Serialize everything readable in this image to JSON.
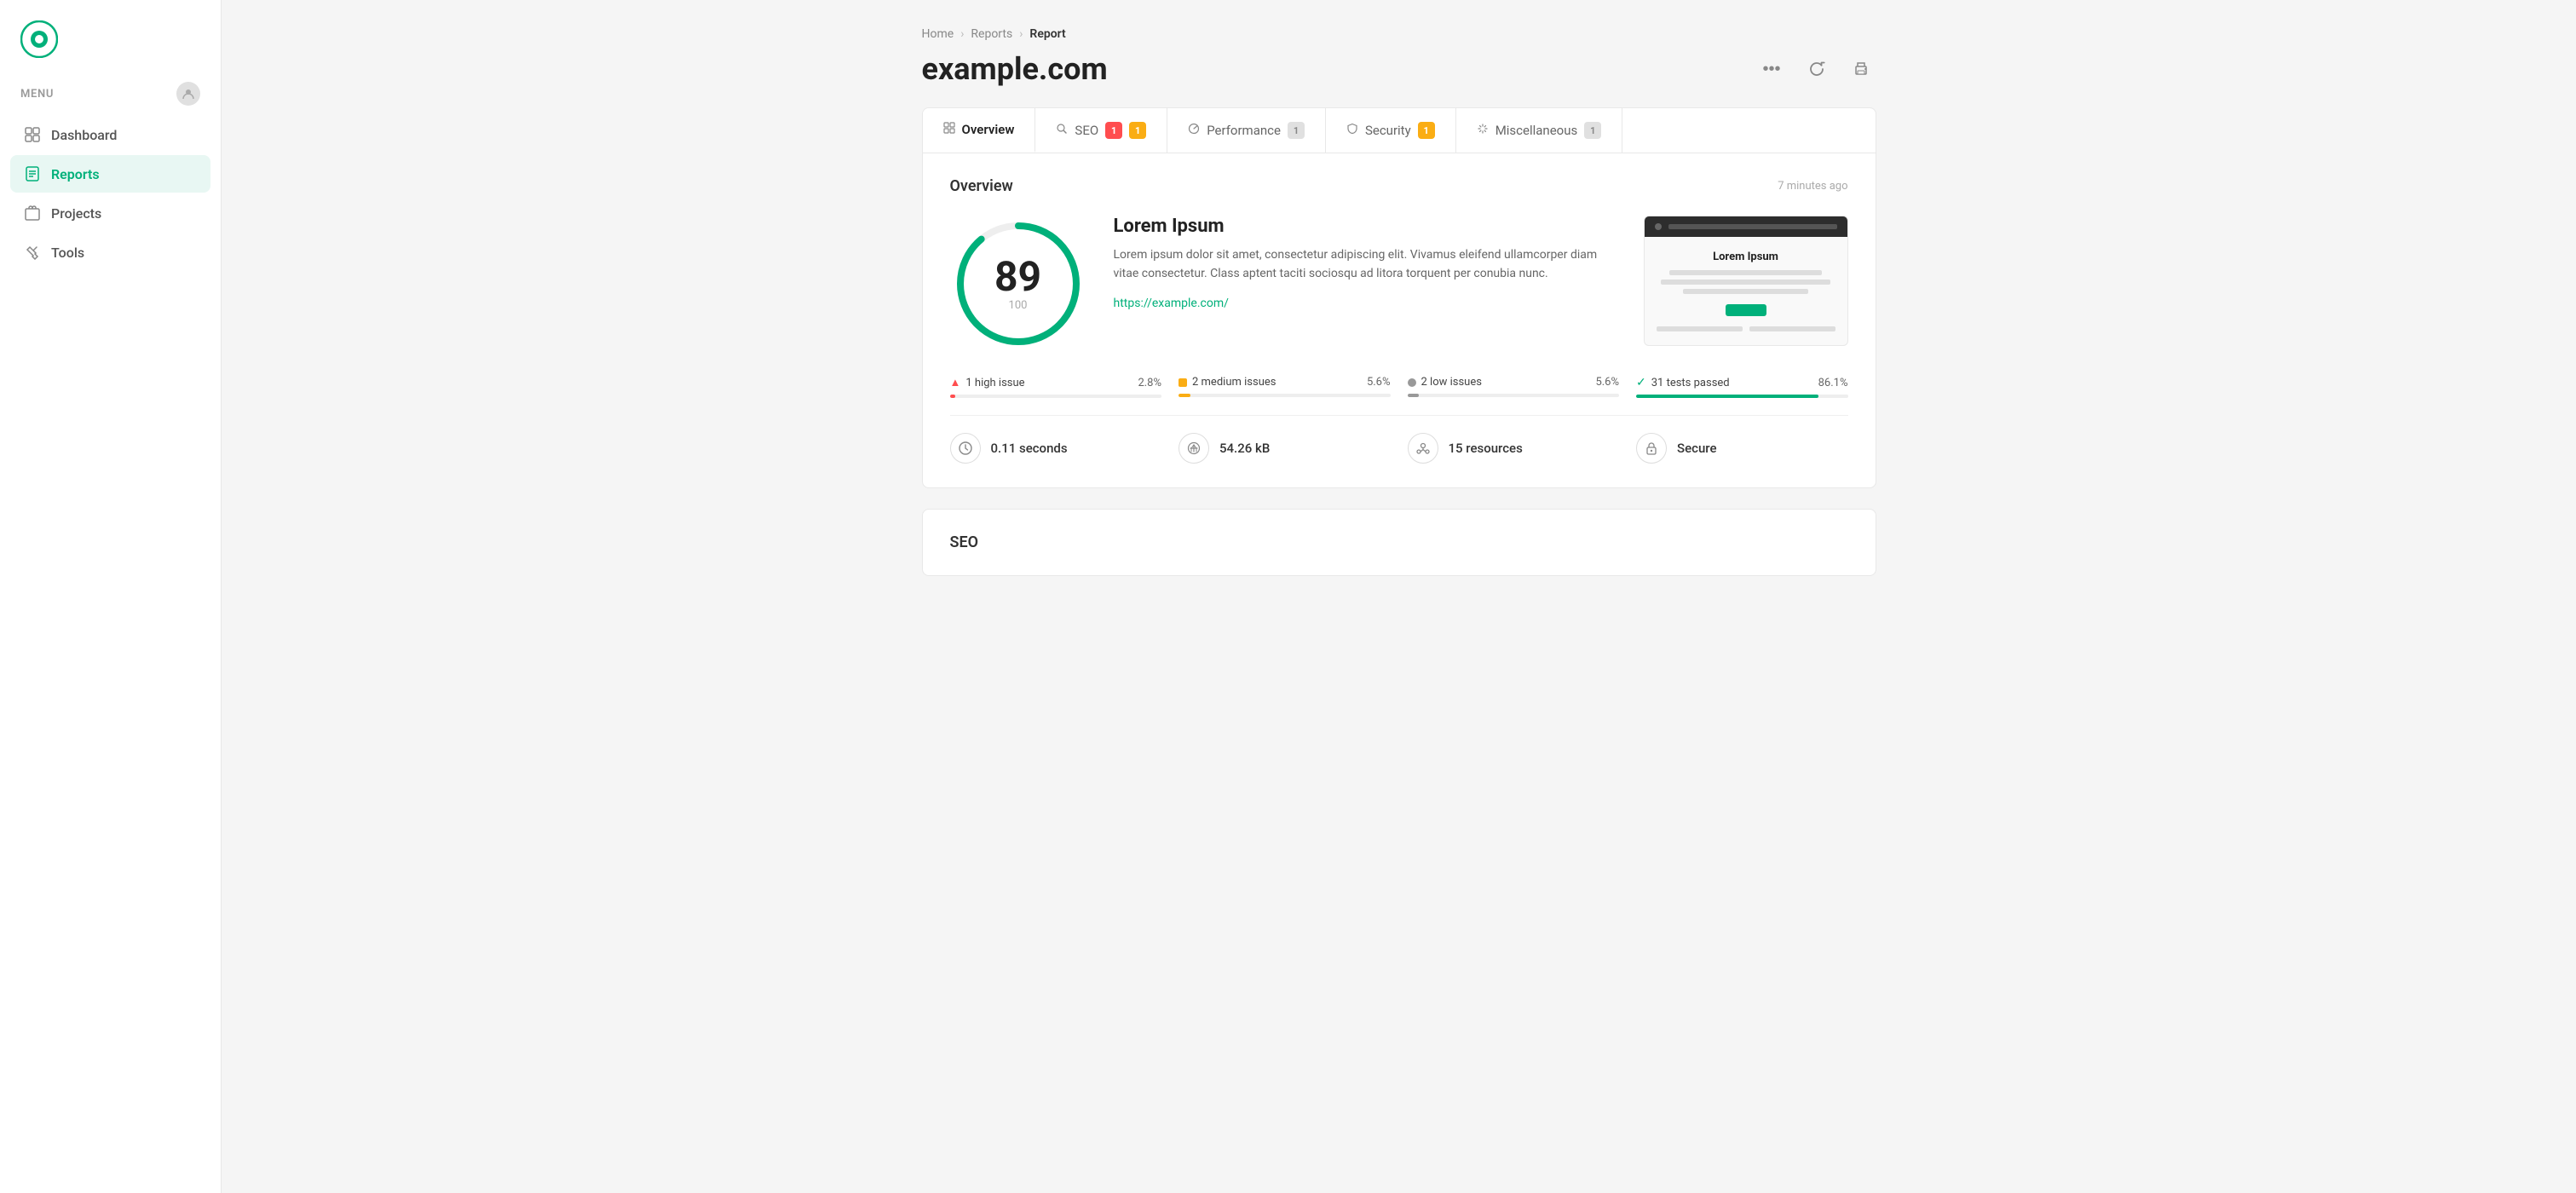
{
  "sidebar": {
    "menu_label": "MENU",
    "nav_items": [
      {
        "id": "dashboard",
        "label": "Dashboard",
        "active": false
      },
      {
        "id": "reports",
        "label": "Reports",
        "active": true
      },
      {
        "id": "projects",
        "label": "Projects",
        "active": false
      },
      {
        "id": "tools",
        "label": "Tools",
        "active": false
      }
    ]
  },
  "breadcrumb": {
    "home": "Home",
    "reports": "Reports",
    "current": "Report"
  },
  "page": {
    "title": "example.com",
    "actions": {
      "more": "...",
      "refresh": "↻",
      "print": "⎙"
    }
  },
  "tabs": [
    {
      "id": "overview",
      "label": "Overview",
      "active": true,
      "badge": null,
      "badge_type": null
    },
    {
      "id": "seo",
      "label": "SEO",
      "active": false,
      "badge": "1",
      "badge2": "1",
      "badge_type": "red",
      "badge2_type": "yellow"
    },
    {
      "id": "performance",
      "label": "Performance",
      "active": false,
      "badge": "1",
      "badge_type": "gray"
    },
    {
      "id": "security",
      "label": "Security",
      "active": false,
      "badge": "1",
      "badge_type": "yellow"
    },
    {
      "id": "miscellaneous",
      "label": "Miscellaneous",
      "active": false,
      "badge": "1",
      "badge_type": "gray"
    }
  ],
  "overview": {
    "title": "Overview",
    "timestamp": "7 minutes ago",
    "score": {
      "value": 89,
      "total": 100,
      "percentage": 89
    },
    "site": {
      "title": "Lorem Ipsum",
      "description": "Lorem ipsum dolor sit amet, consectetur adipiscing elit. Vivamus eleifend ullamcorper diam vitae consectetur. Class aptent taciti sociosqu ad litora torquent per conubia nunc.",
      "url": "https://example.com/"
    },
    "issues": [
      {
        "id": "high",
        "icon": "triangle",
        "label": "1 high issue",
        "percent": "2.8%",
        "fill_pct": 2.8,
        "color": "red"
      },
      {
        "id": "medium",
        "icon": "square",
        "label": "2 medium issues",
        "percent": "5.6%",
        "fill_pct": 5.6,
        "color": "yellow"
      },
      {
        "id": "low",
        "icon": "circle",
        "label": "2 low issues",
        "percent": "5.6%",
        "fill_pct": 5.6,
        "color": "gray"
      },
      {
        "id": "passed",
        "icon": "check",
        "label": "31 tests passed",
        "percent": "86.1%",
        "fill_pct": 86.1,
        "color": "green"
      }
    ],
    "stats": [
      {
        "id": "time",
        "icon": "⏱",
        "value": "0.11 seconds"
      },
      {
        "id": "size",
        "icon": "⚖",
        "value": "54.26 kB"
      },
      {
        "id": "resources",
        "icon": "⚙",
        "value": "15 resources"
      },
      {
        "id": "secure",
        "icon": "🔒",
        "value": "Secure"
      }
    ],
    "preview": {
      "title": "Lorem Ipsum"
    }
  },
  "seo_section": {
    "title": "SEO"
  },
  "colors": {
    "brand_green": "#00b07a",
    "accent_green_light": "#e8f7f3",
    "sidebar_border": "#e8e8e8"
  }
}
